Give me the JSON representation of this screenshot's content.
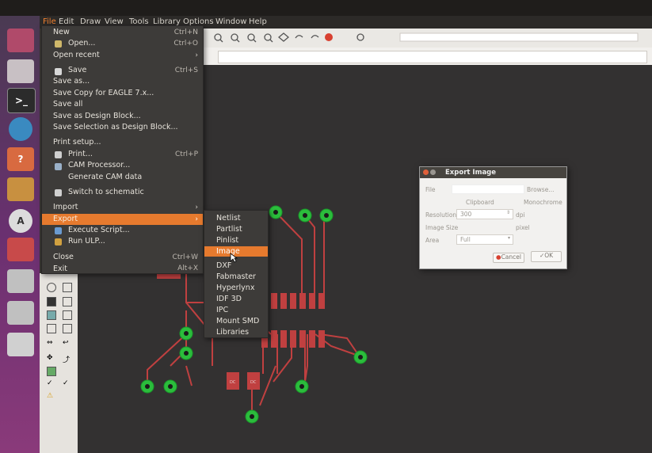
{
  "menubar": {
    "items": [
      "File",
      "Edit",
      "Draw",
      "View",
      "Tools",
      "Library",
      "Options",
      "Window",
      "Help"
    ]
  },
  "file_menu": {
    "items": [
      {
        "label": "New",
        "shortcut": "Ctrl+N"
      },
      {
        "label": "Open...",
        "shortcut": "Ctrl+O"
      },
      {
        "label": "Open recent",
        "submenu": true
      },
      {
        "label": "Save",
        "shortcut": "Ctrl+S"
      },
      {
        "label": "Save as..."
      },
      {
        "label": "Save Copy for EAGLE 7.x..."
      },
      {
        "label": "Save all"
      },
      {
        "label": "Save as Design Block..."
      },
      {
        "label": "Save Selection as Design Block..."
      },
      {
        "label": "Print setup..."
      },
      {
        "label": "Print...",
        "shortcut": "Ctrl+P"
      },
      {
        "label": "CAM Processor..."
      },
      {
        "label": "Generate CAM data"
      },
      {
        "label": "Switch to schematic"
      },
      {
        "label": "Import",
        "submenu": true
      },
      {
        "label": "Export",
        "submenu": true,
        "highlighted": true
      },
      {
        "label": "Execute Script..."
      },
      {
        "label": "Run ULP..."
      },
      {
        "label": "Close",
        "shortcut": "Ctrl+W"
      },
      {
        "label": "Exit",
        "shortcut": "Alt+X"
      }
    ]
  },
  "export_submenu": {
    "items": [
      "Netlist",
      "Partlist",
      "Pinlist",
      "Image",
      "DXF",
      "Fabmaster",
      "Hyperlynx",
      "IDF 3D",
      "IPC",
      "Mount SMD",
      "Libraries"
    ],
    "highlighted": "Image"
  },
  "dialog": {
    "title": "Export Image",
    "file_label": "File",
    "browse": "Browse...",
    "clipboard": "Clipboard",
    "monochrome": "Monochrome",
    "resolution_label": "Resolution",
    "resolution_value": "300",
    "resolution_unit": "dpi",
    "image_size_label": "Image Size",
    "image_size_unit": "pixel",
    "area_label": "Area",
    "area_value": "Full",
    "cancel": "Cancel",
    "ok": "OK"
  },
  "pcb": {
    "part_labels": [
      "DC",
      "DC"
    ]
  },
  "colors": {
    "menu_bg": "#3d3b39",
    "highlight": "#e67a2e",
    "trace": "#c04040",
    "via": "#2bbd3c",
    "canvas": "#333131"
  }
}
